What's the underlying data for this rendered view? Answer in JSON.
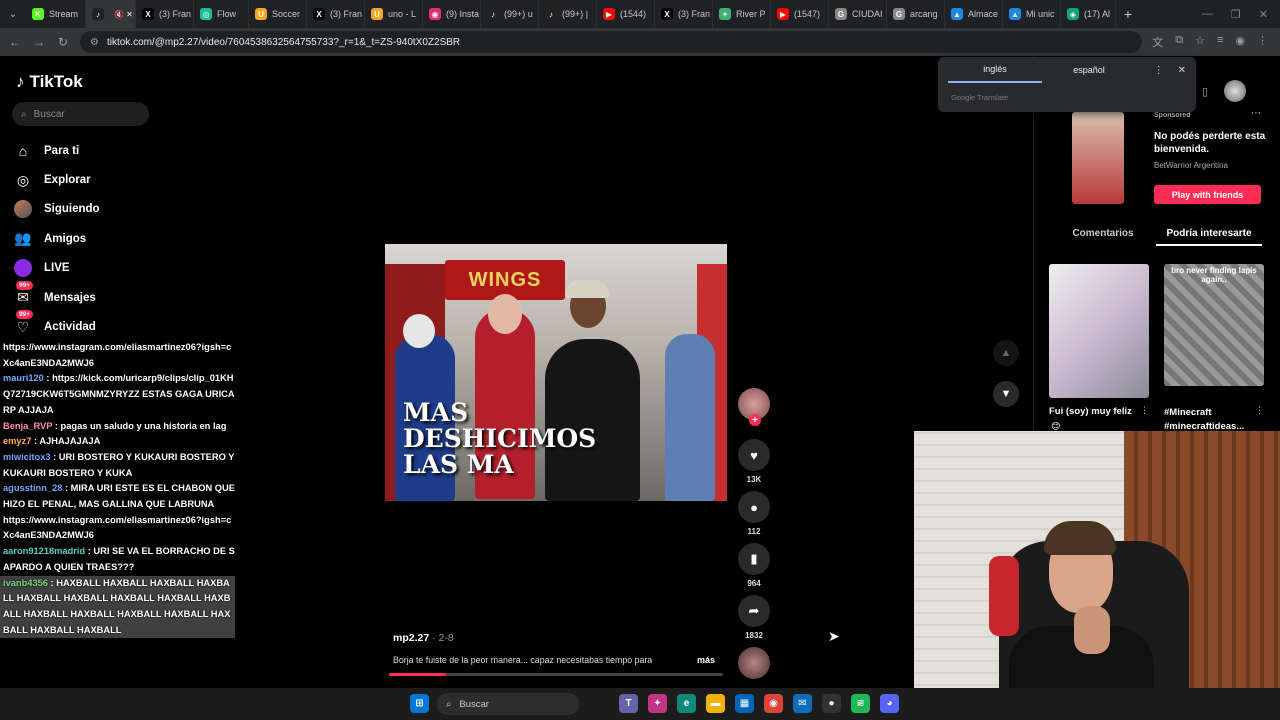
{
  "browser": {
    "tabs": [
      {
        "label": "Stream",
        "color": "#53fc18",
        "glyph": "K"
      },
      {
        "label": "",
        "color": "#222",
        "glyph": "♪",
        "active": true
      },
      {
        "label": "(3) Fran",
        "color": "#000",
        "glyph": "X"
      },
      {
        "label": "Flow",
        "color": "#1abc9c",
        "glyph": "◎"
      },
      {
        "label": "Soccer",
        "color": "#f5a623",
        "glyph": "U"
      },
      {
        "label": "(3) Fran",
        "color": "#000",
        "glyph": "X"
      },
      {
        "label": "uno - L",
        "color": "#f5a623",
        "glyph": "U"
      },
      {
        "label": "(9) Insta",
        "color": "#e1306c",
        "glyph": "◉"
      },
      {
        "label": "(99+) u",
        "color": "#222",
        "glyph": "♪"
      },
      {
        "label": "(99+) |",
        "color": "#222",
        "glyph": "♪"
      },
      {
        "label": "(1544)",
        "color": "#ff0000",
        "glyph": "▶"
      },
      {
        "label": "(3) Fran",
        "color": "#000",
        "glyph": "X"
      },
      {
        "label": "River P",
        "color": "#3cb371",
        "glyph": "✦"
      },
      {
        "label": "(1547)",
        "color": "#ff0000",
        "glyph": "▶"
      },
      {
        "label": "CIUDAI",
        "color": "#888",
        "glyph": "G"
      },
      {
        "label": "arcang",
        "color": "#888",
        "glyph": "G"
      },
      {
        "label": "Almace",
        "color": "#1e88e5",
        "glyph": "▲"
      },
      {
        "label": "Mi unic",
        "color": "#1e88e5",
        "glyph": "▲"
      },
      {
        "label": "(17) Al",
        "color": "#10a37f",
        "glyph": "◈"
      }
    ],
    "url": "tiktok.com/@mp2.27/video/7604538632564755733?_r=1&_t=ZS-940tX0Z2SBR"
  },
  "translate": {
    "tab_source": "inglés",
    "tab_target": "español",
    "footer": "Google Translate"
  },
  "tiktok": {
    "logo": "TikTok",
    "search_placeholder": "Buscar",
    "nav": [
      {
        "label": "Para ti",
        "icon": "home-icon"
      },
      {
        "label": "Explorar",
        "icon": "compass-icon"
      },
      {
        "label": "Siguiendo",
        "icon": "following-icon"
      },
      {
        "label": "Amigos",
        "icon": "friends-icon"
      },
      {
        "label": "LIVE",
        "icon": "live-icon"
      },
      {
        "label": "Mensajes",
        "icon": "messages-icon",
        "badge": "99+"
      },
      {
        "label": "Actividad",
        "icon": "activity-icon",
        "badge": "99+"
      }
    ],
    "video_overlay_text": [
      "MAS",
      "DESHICIMOS",
      "LAS MA"
    ],
    "video_sign": "WINGS",
    "actions": {
      "likes": "13K",
      "comments": "112",
      "saves": "964",
      "shares": "1832"
    },
    "caption": {
      "username": "mp2.27",
      "date": " · 2-8",
      "text": "Borja te fuiste de la peor manera... capaz necesitabas tiempo para",
      "more": "más",
      "progress": 0.17
    },
    "ad": {
      "sponsored": "Sponsored",
      "title": "No podés perderte esta bienvenida.",
      "advertiser": "BetWarrior Argentina",
      "cta": "Play with friends"
    },
    "right_tabs": [
      "Comentarios",
      "Podría interesarte"
    ],
    "suggestions": [
      {
        "title": "Fui (soy) muy feliz",
        "emoji": "😊"
      },
      {
        "title": "#Minecraft #minecraftideas...",
        "thumb_text": "bro never finding lapis again.."
      }
    ]
  },
  "chat": [
    {
      "user": "",
      "text": "https://www.instagram.com/eliasmartinez06?igsh=cXc4anE3NDA2MWJ6",
      "color": ""
    },
    {
      "user": "mauri120",
      "text": " : https://kick.com/uricarp9/clips/clip_01KHQ72719CKW6T5GMNMZYRYZZ ESTAS GAGA URICARP AJJAJA",
      "color": "blue"
    },
    {
      "user": "Benja_RVP",
      "text": " : pagas un saludo y una historia en lag",
      "color": "pink"
    },
    {
      "user": "emyz7",
      "text": " : AJHAJAJAJA",
      "color": ""
    },
    {
      "user": "miwicitox3",
      "text": " : URI BOSTERO Y KUKAURI BOSTERO Y KUKAURI BOSTERO Y KUKA",
      "color": "blue"
    },
    {
      "user": "agusstinn_28",
      "text": " : MIRA URI ESTE ES EL CHABON QUE HIZO EL PENAL, MAS GALLINA QUE LABRUNA",
      "color": "blue"
    },
    {
      "user": "",
      "text": "https://www.instagram.com/eliasmartinez06?igsh=cXc4anE3NDA2MWJ6",
      "color": ""
    },
    {
      "user": "aaron91218madrid",
      "text": " : URI SE VA EL BORRACHO DE SAPARDO A QUIEN TRAES???",
      "color": "cyan"
    },
    {
      "user": "ivanb4356",
      "text": " : HAXBALL HAXBALL HAXBALL HAXBALL HAXBALL HAXBALL HAXBALL HAXBALL HAXBALL HAXBALL HAXBALL HAXBALL HAXBALL HAXBALL HAXBALL HAXBALL",
      "color": "green"
    }
  ],
  "taskbar": {
    "search": "Buscar"
  }
}
